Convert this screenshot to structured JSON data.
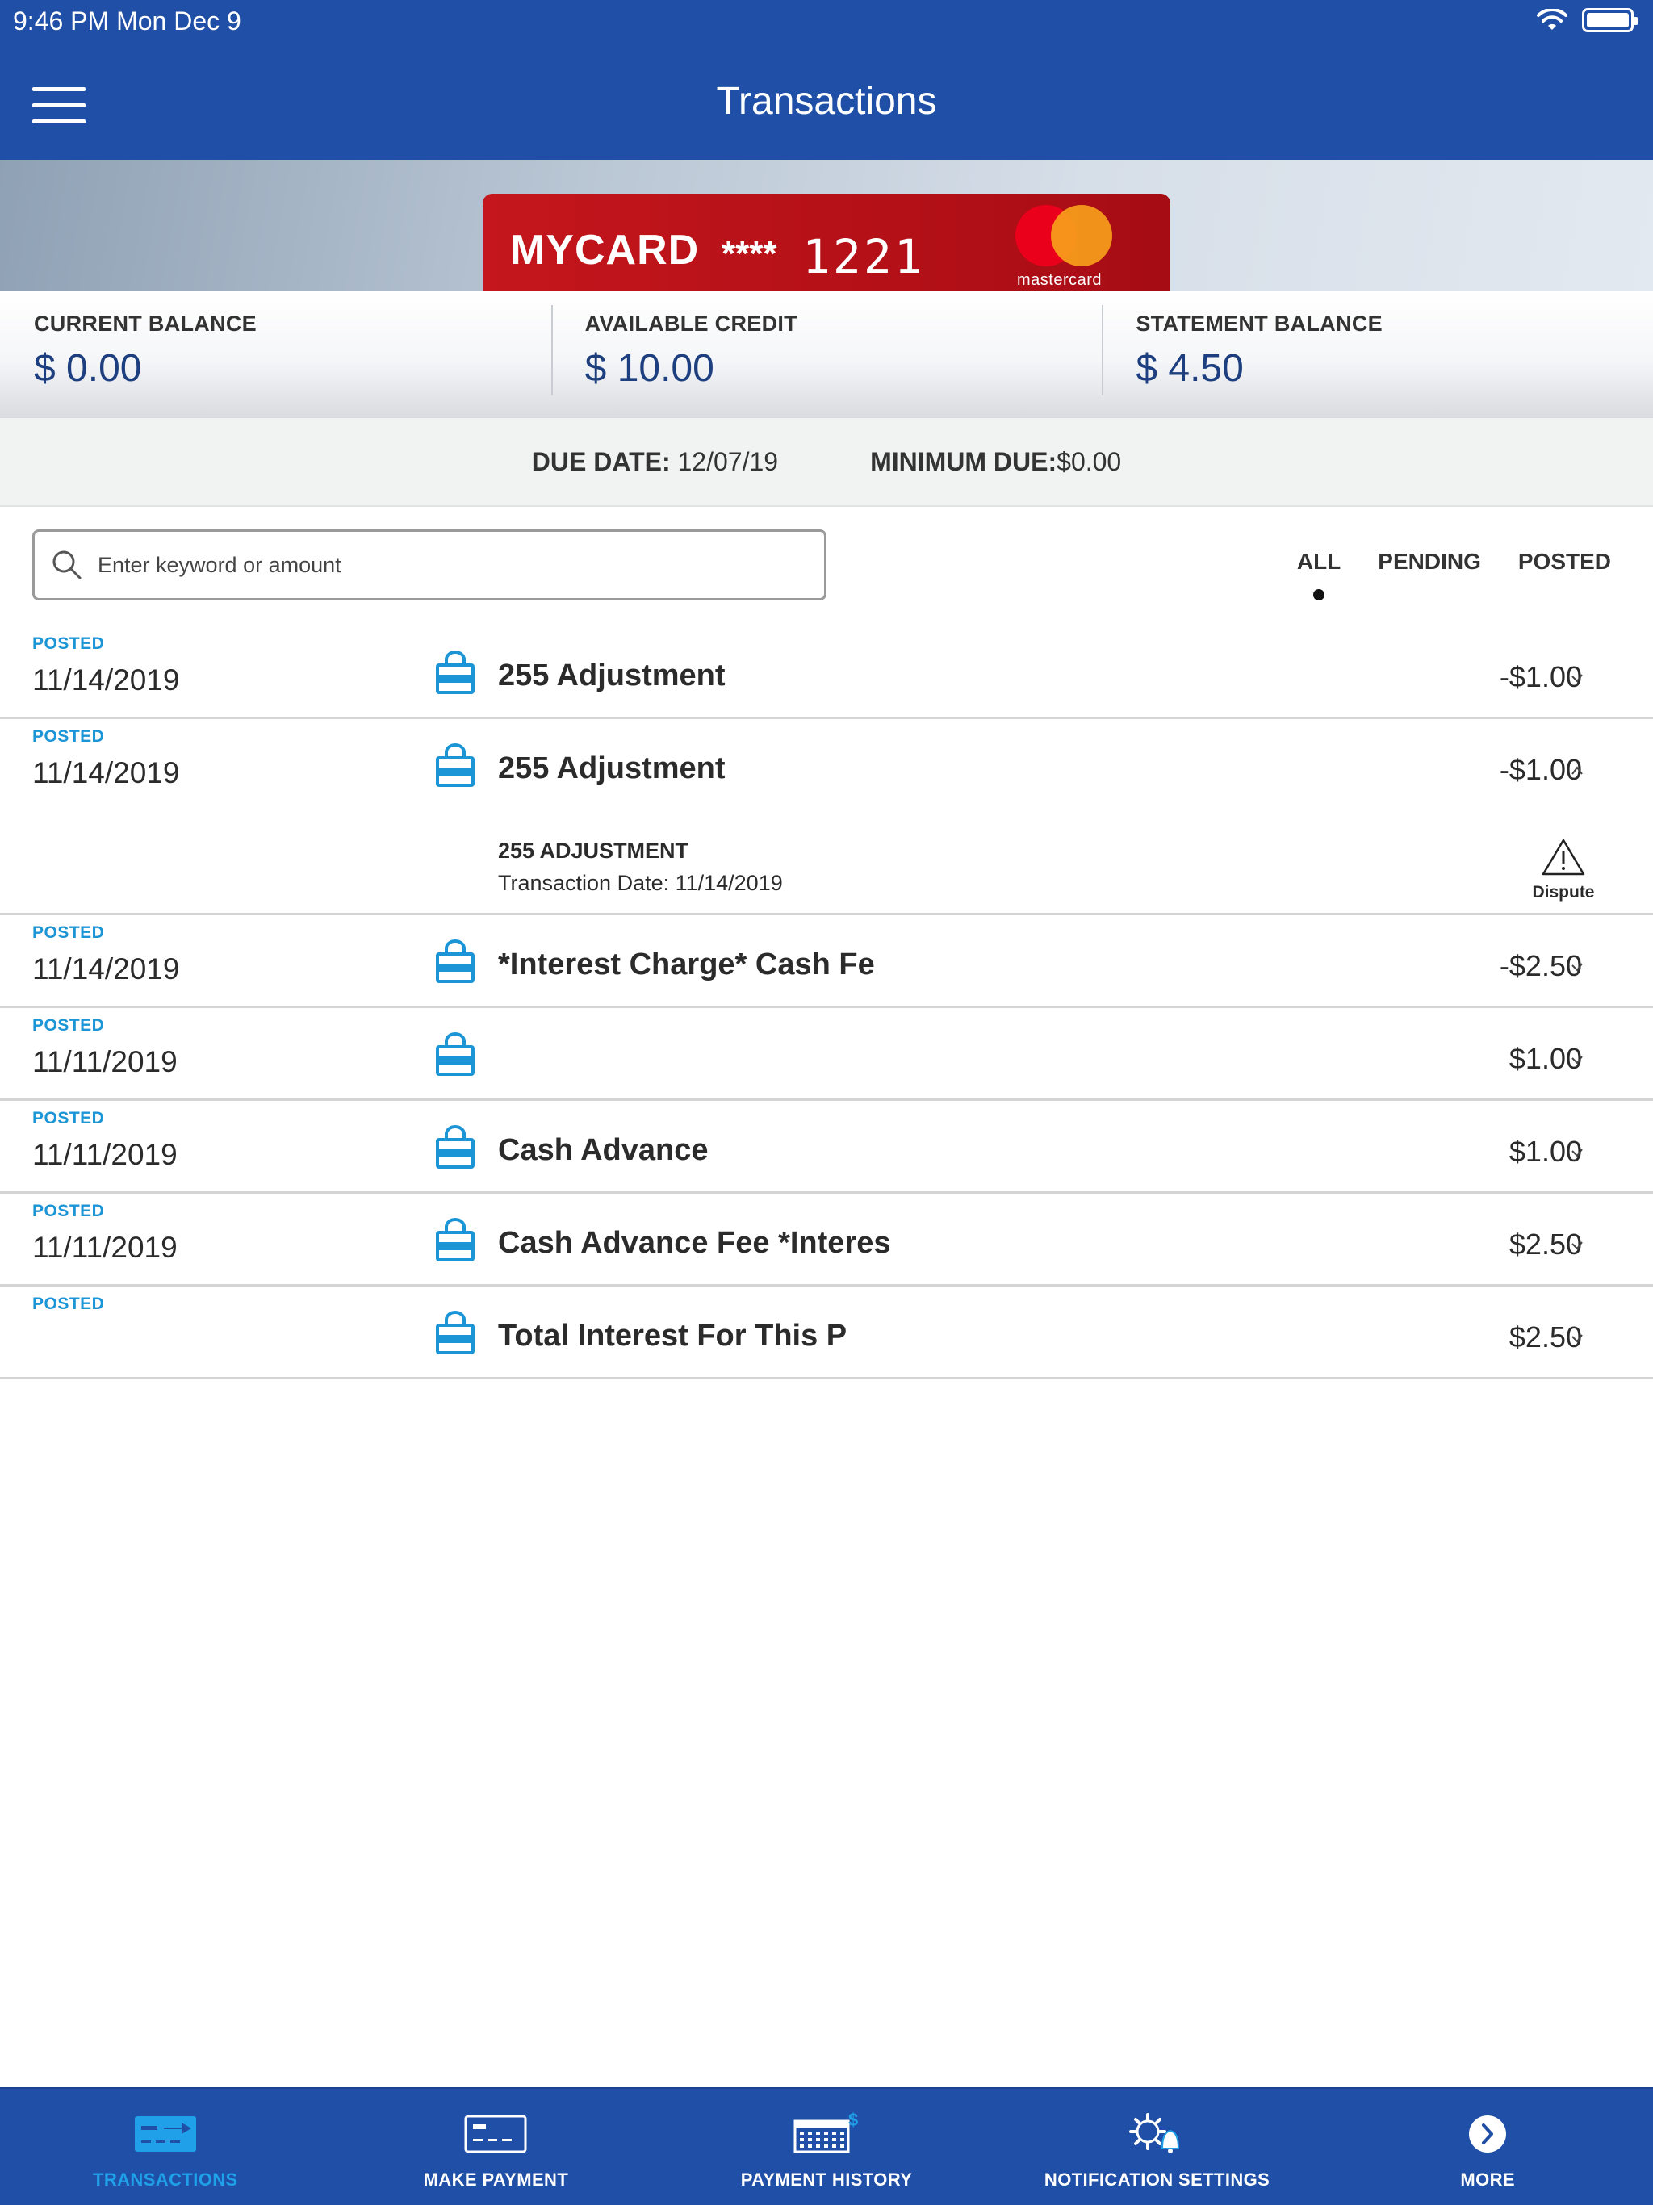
{
  "status_bar": {
    "time": "9:46 PM   Mon Dec 9",
    "wifi_icon": "wifi-icon",
    "battery_icon": "battery-icon"
  },
  "header": {
    "title": "Transactions",
    "menu_icon": "hamburger-menu-icon"
  },
  "card": {
    "name": "MYCARD",
    "masked": "****",
    "last4": "1221",
    "brand": "mastercard",
    "brand_colors": [
      "#eb001b",
      "#f79e1b"
    ]
  },
  "balances": [
    {
      "label": "CURRENT BALANCE",
      "value": "$ 0.00"
    },
    {
      "label": "AVAILABLE CREDIT",
      "value": "$ 10.00"
    },
    {
      "label": "STATEMENT BALANCE",
      "value": "$ 4.50"
    }
  ],
  "due": {
    "due_label": "DUE DATE:",
    "due_value": "12/07/19",
    "min_label": "MINIMUM DUE:",
    "min_value": "$0.00"
  },
  "search": {
    "placeholder": "Enter keyword or amount",
    "value": ""
  },
  "filters": {
    "items": [
      "ALL",
      "PENDING",
      "POSTED"
    ],
    "selected": "ALL"
  },
  "transactions": [
    {
      "status": "POSTED",
      "date": "11/14/2019",
      "name": "255 Adjustment",
      "amount": "-$1.00",
      "icon": "shopping-bag-icon"
    },
    {
      "status": "POSTED",
      "date": "11/14/2019",
      "name": "255 Adjustment",
      "amount": "-$1.00",
      "icon": "shopping-bag-icon",
      "detail_title": "255 ADJUSTMENT",
      "detail_date": "Transaction Date: 11/14/2019",
      "dispute_label": "Dispute"
    },
    {
      "status": "POSTED",
      "date": "11/14/2019",
      "name": "*Interest Charge* Cash Fe",
      "amount": "-$2.50",
      "icon": "shopping-bag-icon"
    },
    {
      "status": "POSTED",
      "date": "11/11/2019",
      "name": "",
      "amount": "$1.00",
      "icon": "shopping-bag-icon"
    },
    {
      "status": "POSTED",
      "date": "11/11/2019",
      "name": "Cash Advance",
      "amount": "$1.00",
      "icon": "shopping-bag-icon"
    },
    {
      "status": "POSTED",
      "date": "11/11/2019",
      "name": "Cash Advance Fee *Interes",
      "amount": "$2.50",
      "icon": "shopping-bag-icon"
    },
    {
      "status": "POSTED",
      "date": "",
      "name": "Total Interest For This P",
      "amount": "$2.50",
      "icon": "shopping-bag-icon"
    }
  ],
  "tabbar": {
    "items": [
      {
        "label": "TRANSACTIONS",
        "icon": "transactions-icon",
        "active": true
      },
      {
        "label": "MAKE PAYMENT",
        "icon": "card-payment-icon",
        "active": false
      },
      {
        "label": "PAYMENT HISTORY",
        "icon": "calendar-dollar-icon",
        "active": false
      },
      {
        "label": "NOTIFICATION SETTINGS",
        "icon": "gear-bell-icon",
        "active": false
      },
      {
        "label": "MORE",
        "icon": "chevron-circle-icon",
        "active": false
      }
    ],
    "active_color": "#1fa0e8",
    "background": "#1f4fa6"
  },
  "colors": {
    "brand_blue": "#1f4fa6",
    "accent": "#1b95d6",
    "balance_blue": "#1d3f7f",
    "card_red": "#c4161c"
  }
}
